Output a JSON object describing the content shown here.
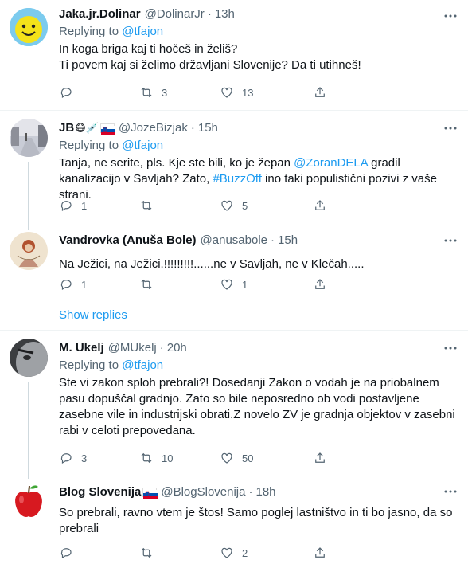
{
  "tweets": [
    {
      "name": "Jaka.jr.Dolinar",
      "handle": "@DolinarJr",
      "time": "13h",
      "replying_label": "Replying to",
      "replying_to": "@tfajon",
      "text": "In koga briga kaj ti hočeš in želiš?\nTi povem kaj si želimo državljani Slovenije? Da ti utihneš!",
      "reply_count": "",
      "retweet_count": "3",
      "like_count": "13"
    },
    {
      "name": "JB",
      "name_emoji": "😷💉",
      "handle": "@JozeBizjak",
      "time": "15h",
      "replying_label": "Replying to",
      "replying_to": "@tfajon",
      "text_part1": "Tanja, ne serite, pls. Kje ste bili, ko je žepan ",
      "text_link1": "@ZoranDELA",
      "text_part2": " gradil kanalizacijo v Savljah? Zato, ",
      "text_link2": "#BuzzOff",
      "text_part3": " ino taki populistični pozivi z vaše strani.",
      "reply_count": "1",
      "retweet_count": "",
      "like_count": "5"
    },
    {
      "name": "Vandrovka (Anuša Bole)",
      "handle": "@anusabole",
      "time": "15h",
      "text": "Na Ježici, na Ježici.!!!!!!!!!......ne v Savljah, ne v Klečah.....",
      "reply_count": "1",
      "retweet_count": "",
      "like_count": "1"
    },
    {
      "name": "M. Ukelj",
      "handle": "@MUkelj",
      "time": "20h",
      "replying_label": "Replying to",
      "replying_to": "@tfajon",
      "text": "Ste vi zakon sploh prebrali?! Dosedanji Zakon o vodah je na priobalnem pasu dopuščal gradnjo. Zato so bile neposredno ob vodi postavljene zasebne vile in industrijski obrati.Z novelo ZV je gradnja objektov v zasebni rabi v celoti prepovedana.",
      "reply_count": "3",
      "retweet_count": "10",
      "like_count": "50"
    },
    {
      "name": "Blog Slovenija",
      "handle": "@BlogSlovenija",
      "time": "18h",
      "text": "So prebrali, ravno vtem je štos! Samo poglej lastništvo in ti bo jasno, da so prebrali",
      "reply_count": "",
      "retweet_count": "",
      "like_count": "2"
    }
  ],
  "show_replies": "Show replies",
  "dot": "·",
  "colors": {
    "accent": "#1d9bf0",
    "muted": "#536471",
    "divider": "#eff3f4"
  },
  "icons": [
    "reply-icon",
    "retweet-icon",
    "like-icon",
    "share-icon",
    "more-icon",
    "slovenia-flag-icon"
  ]
}
